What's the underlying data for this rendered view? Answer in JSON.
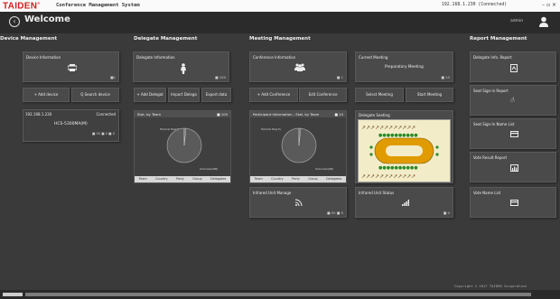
{
  "titlebar": {
    "brand": "TAIDEN",
    "brand_mark": "®",
    "app_title": "Conference Management System",
    "ip_status": "192.168.1.230 (Connected)",
    "window_controls": "– ▫ ×"
  },
  "header": {
    "welcome": "Welcome",
    "user": "admin"
  },
  "sections": {
    "device": "Device Management",
    "delegate": "Delegate Management",
    "meeting": "Meeting Management",
    "report": "Report Management"
  },
  "device": {
    "info_title": "Device Information",
    "info_count": "■1",
    "add_label": "+ Add device",
    "search_label": "Q Search device",
    "card_ip": "192.168.1.230",
    "card_status": "Connected",
    "card_name": "HCS-5300MA(M)",
    "card_counts": "■ 00  ■ 0  ■ 0"
  },
  "delegate": {
    "info_title": "Delegate Information",
    "info_count": "■ 100",
    "add_label": "+ Add Delegat",
    "import_label": "Import Delega",
    "export_label": "Export data",
    "stat_title": "Stat. by Team",
    "stat_count": "■ 100",
    "pie_top": "Tutorial Pop(3)",
    "pie_bottom": "Unknown(98)",
    "legend": [
      "Team",
      "Country",
      "Party",
      "Group",
      "Delegates"
    ]
  },
  "meeting": {
    "conf_title": "Conference Information",
    "conf_count": "■ 1",
    "current_title": "Current Meeting",
    "current_name": "Preparatory Meeting",
    "current_count": "■ 10",
    "add_conf": "+ Add Conference",
    "edit_conf": "Edit Conference",
    "select_meeting": "Select Meeting",
    "start_meeting": "Start Meeting",
    "participant_title": "Participant Information - Stat. by Team",
    "participant_count": "■ 10",
    "pie_top": "Tutorial Pop(3)",
    "pie_bottom": "Unknown(98)",
    "legend": [
      "Team",
      "Country",
      "Party",
      "Group",
      "Delegates"
    ],
    "seating_title": "Delegate Seating",
    "infrared_title": "Infrared Unit Manage",
    "infrared_count": "■ 00  ■ 0",
    "infrared_status_title": "Infrared Unit Status",
    "infrared_status_count": "■ 0"
  },
  "report": {
    "items": [
      "Delegate Info. Report",
      "Seat Sign-in Report",
      "Seat Sign-In Name List",
      "Vote Result Report",
      "Vote Name List"
    ]
  },
  "footer": {
    "copyright": "Copyright © 2017 TAIDEN Corporation"
  },
  "colors": {
    "background": "#3a3a3a",
    "tile": "#4a4a4a",
    "brand_red": "#d21e1e",
    "seat_bg": "#f3ecc8",
    "seat_color": "#e09b00"
  }
}
